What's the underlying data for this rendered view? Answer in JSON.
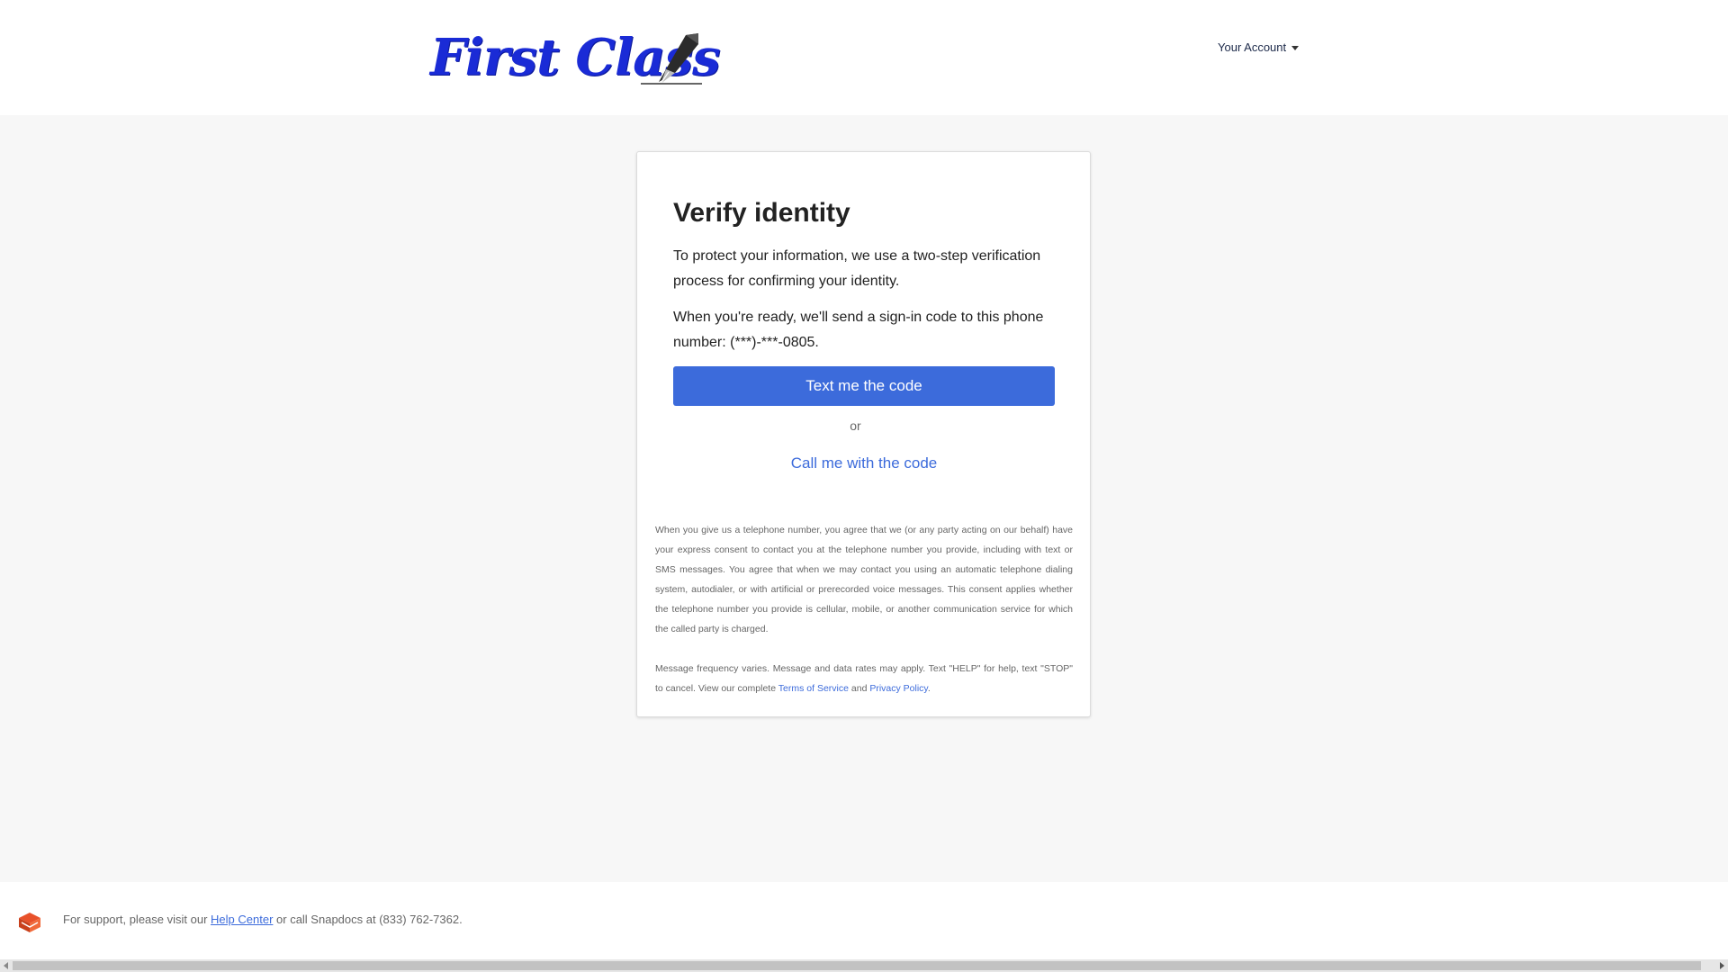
{
  "header": {
    "logo_text": "First Class",
    "logo_icon": "fountain-pen-icon",
    "account_menu_label": "Your Account",
    "account_menu_icon": "caret-down-icon"
  },
  "card": {
    "title": "Verify identity",
    "intro": "To protect your information, we use a two-step verification process for confirming your identity.",
    "phone_prompt": "When you're ready, we'll send a sign-in code to this phone number: (***)-***-0805.",
    "text_button_label": "Text me the code",
    "or_label": "or",
    "call_link_label": "Call me with the code",
    "consent_text": "When you give us a telephone number, you agree that we (or any party acting on our behalf) have your express consent to contact you at the telephone number you provide, including with text or SMS messages. You agree that when we may contact you using an automatic telephone dialing system, autodialer, or with artificial or prerecorded voice messages. This consent applies whether the telephone number you provide is cellular, mobile, or another communication service for which the called party is charged.",
    "frequency_text_before": "Message frequency varies. Message and data rates may apply. Text \"HELP\" for help, text \"STOP\" to cancel. View our complete ",
    "terms_link_label": "Terms of Service",
    "and_label": " and ",
    "privacy_link_label": "Privacy Policy",
    "period": "."
  },
  "footer": {
    "icon": "snapdocs-logo-icon",
    "support_before": "For support, please visit our ",
    "help_center_label": "Help Center",
    "support_after": " or call Snapdocs at (833) 762-7362."
  },
  "colors": {
    "accent": "#3c6bdb",
    "logo_blue": "#1a2bd6",
    "footer_icon": "#e8512a",
    "page_background": "#f7f7f7"
  }
}
